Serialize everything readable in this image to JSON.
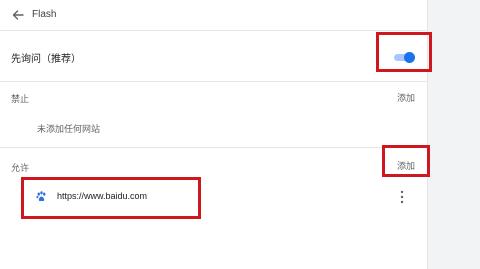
{
  "header": {
    "title": "Flash",
    "back_icon": "arrow-left-icon"
  },
  "ask_setting": {
    "label": "先询问（推荐）",
    "enabled": true,
    "accent_color": "#1a73e8"
  },
  "block_section": {
    "label": "禁止",
    "add_label": "添加",
    "empty_text": "未添加任何网站"
  },
  "allow_section": {
    "label": "允许",
    "add_label": "添加",
    "sites": [
      {
        "url": "https://www.baidu.com",
        "favicon": "baidu-paw-icon",
        "menu_icon": "more-vert-icon"
      }
    ]
  },
  "annotation_color": "#d0161f"
}
